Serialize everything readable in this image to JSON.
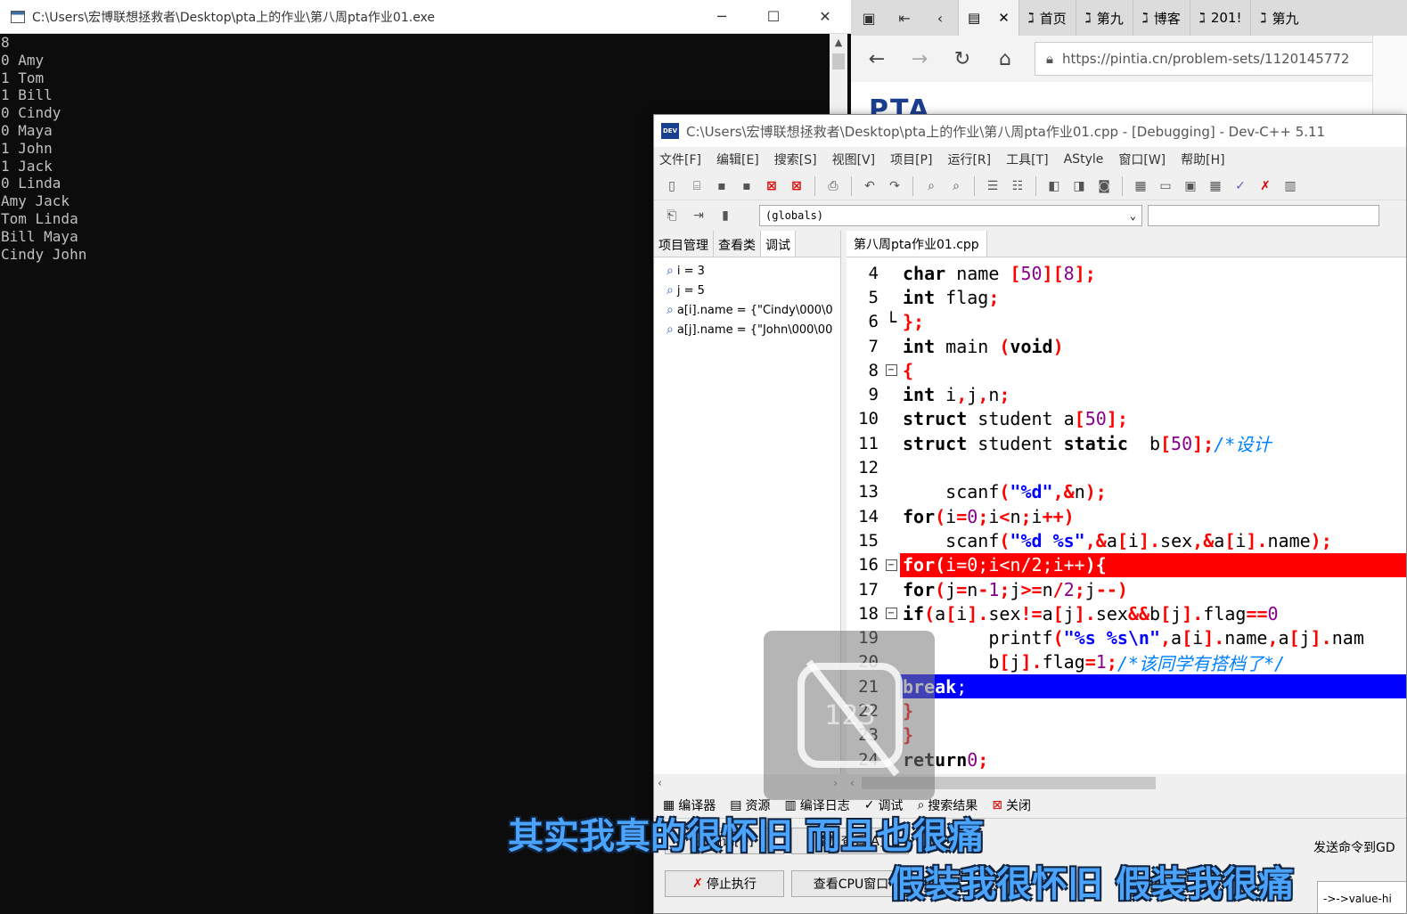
{
  "console": {
    "title": "C:\\Users\\宏博联想拯救者\\Desktop\\pta上的作业\\第八周pta作业01.exe",
    "output": "8\n0 Amy\n1 Tom\n1 Bill\n0 Cindy\n0 Maya\n1 John\n1 Jack\n0 Linda\nAmy Jack\nTom Linda\nBill Maya\nCindy John",
    "controls": {
      "minimize": "─",
      "maximize": "☐",
      "close": "✕"
    }
  },
  "browser": {
    "tabs": [
      {
        "label": "首页",
        "icon": "pta-icon"
      },
      {
        "label": "第九",
        "icon": "pta-icon"
      },
      {
        "label": "博客",
        "icon": "pta-icon"
      },
      {
        "label": "201!",
        "icon": "pta-icon"
      },
      {
        "label": "第九",
        "icon": "pta-icon"
      }
    ],
    "url": "https://pintia.cn/problem-sets/1120145772",
    "logo": "PTA"
  },
  "devcpp": {
    "title": "C:\\Users\\宏博联想拯救者\\Desktop\\pta上的作业\\第八周pta作业01.cpp - [Debugging] - Dev-C++ 5.11",
    "menu": [
      "文件[F]",
      "编辑[E]",
      "搜索[S]",
      "视图[V]",
      "项目[P]",
      "运行[R]",
      "工具[T]",
      "AStyle",
      "窗口[W]",
      "帮助[H]"
    ],
    "scope_combo": "(globals)",
    "left_tabs": [
      "项目管理",
      "查看类",
      "调试"
    ],
    "watches": [
      "i = 3",
      "j = 5",
      "a[i].name = {\"Cindy\\000\\0",
      "a[j].name = {\"John\\000\\00"
    ],
    "editor_tab": "第八周pta作业01.cpp",
    "line_numbers": [
      "4",
      "5",
      "6",
      "7",
      "8",
      "9",
      "10",
      "11",
      "12",
      "13",
      "14",
      "15",
      "16",
      "17",
      "18",
      "19",
      "20",
      "21",
      "22",
      "23",
      "24"
    ],
    "bottom_tabs": [
      "编译器",
      "资源",
      "编译日志",
      "调试",
      "搜索结果",
      "关闭"
    ],
    "buttons": {
      "debug": "调试[D]",
      "add_watch": "添加查看[A]",
      "stop": "停止执行",
      "cpu_window": "查看CPU窗口"
    },
    "cmd_label": "发送命令到GD",
    "cmd_value": "->->value-hi"
  },
  "overlay": {
    "text": "123"
  },
  "subtitles": {
    "line1": "其实我真的很怀旧 而且也很痛",
    "line2": "假装我很怀旧 假装我很痛"
  }
}
